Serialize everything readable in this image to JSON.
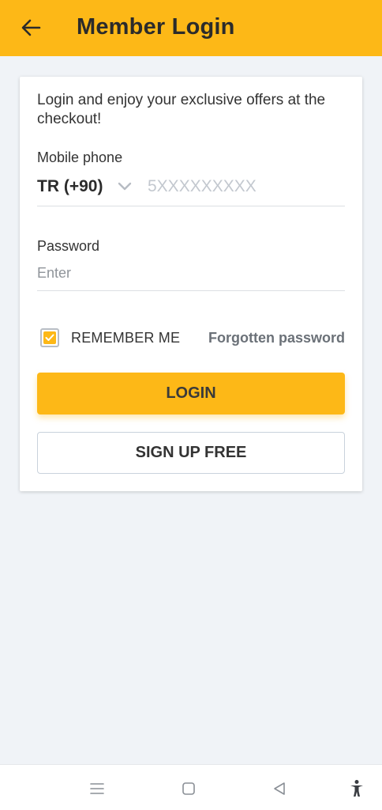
{
  "header": {
    "title": "Member Login",
    "back_icon": "arrow-left-icon"
  },
  "form": {
    "intro": "Login and enjoy your exclusive offers at the checkout!",
    "phone_label": "Mobile phone",
    "country_code": "TR (+90)",
    "phone_placeholder": "5XXXXXXXXX",
    "phone_value": "",
    "password_label": "Password",
    "password_placeholder": "Enter",
    "password_value": "",
    "remember_label": "REMEMBER ME",
    "remember_checked": true,
    "forgot_label": "Forgotten password",
    "login_label": "LOGIN",
    "signup_label": "SIGN UP FREE"
  },
  "navbar": {
    "icons": [
      "menu-icon",
      "home-square-icon",
      "back-triangle-icon",
      "accessibility-icon"
    ]
  },
  "colors": {
    "accent": "#fdb817",
    "background": "#f0f3f7",
    "card": "#ffffff"
  }
}
